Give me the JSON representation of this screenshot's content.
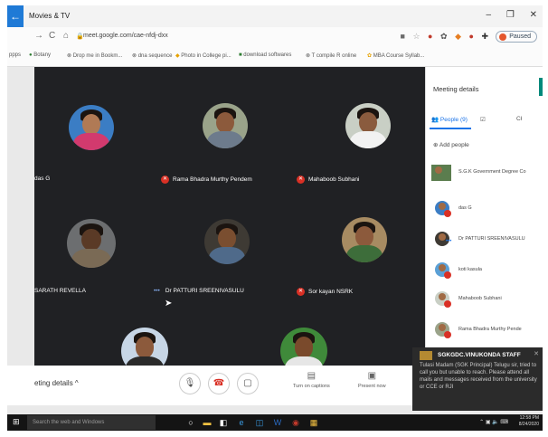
{
  "app": {
    "back_glyph": "←",
    "title": "Movies & TV",
    "controls": [
      "–",
      "❐",
      "✕"
    ]
  },
  "browser": {
    "nav": [
      "→",
      "C",
      "⌂"
    ],
    "url": "meet.google.com/cae-nfdj-dxx",
    "profile_status": "Paused",
    "bookmarks": [
      "ppps",
      "Botany",
      "Drop me in Bookm...",
      "dna sequence",
      "Photo in College pi...",
      "download softwares",
      "compile R online",
      "MBA Course Syllab..."
    ]
  },
  "meet": {
    "participants": [
      {
        "name": "das G",
        "muted": false
      },
      {
        "name": "Rama Bhadra Murthy Pendem",
        "muted": true
      },
      {
        "name": "Mahaboob Subhani",
        "muted": true
      },
      {
        "name": "SARATH REVELLA",
        "muted": false
      },
      {
        "name": "Dr PATTURI SREENIVASULU",
        "muted": false,
        "speaking_dots": "•••"
      },
      {
        "name": "Sor kayan NSRK",
        "muted": true
      }
    ],
    "bottom_bar": {
      "details_label": "eting details  ^",
      "mic_glyph": "🎙",
      "end_glyph": "☎",
      "present_glyph": "▣",
      "captions_label": "Turn on captions",
      "present_label": "Present now"
    }
  },
  "panel": {
    "title": "Meeting details",
    "tabs": [
      {
        "label": "People (9)",
        "active": true
      },
      {
        "label": "☑",
        "active": false
      },
      {
        "label": "Cł",
        "active": false
      }
    ],
    "add_people": "Add people",
    "people": [
      "S.G.K Government Degree Co",
      "das G",
      "Dr PATTURI SREENIVASULU",
      "koti kasula",
      "Mahaboob Subhani",
      "Rama Bhadra Murthy Pende"
    ]
  },
  "toast": {
    "title": "SGKGDC.VINUKONDA STAFF",
    "body": "Tulasi Madam (SGK Principal) Telugu sir, tried to call you but unable to reach. Please attend all mails and messages received from the university or CCE or RJI",
    "close": "✕"
  },
  "taskbar": {
    "search_placeholder": "Search the web and Windows",
    "time": "12:58 PM",
    "date": "8/24/2020"
  },
  "colors": {
    "meet_bg": "#202124",
    "accent": "#1a73e8",
    "danger": "#d93025",
    "panel_accent": "#00897b"
  }
}
